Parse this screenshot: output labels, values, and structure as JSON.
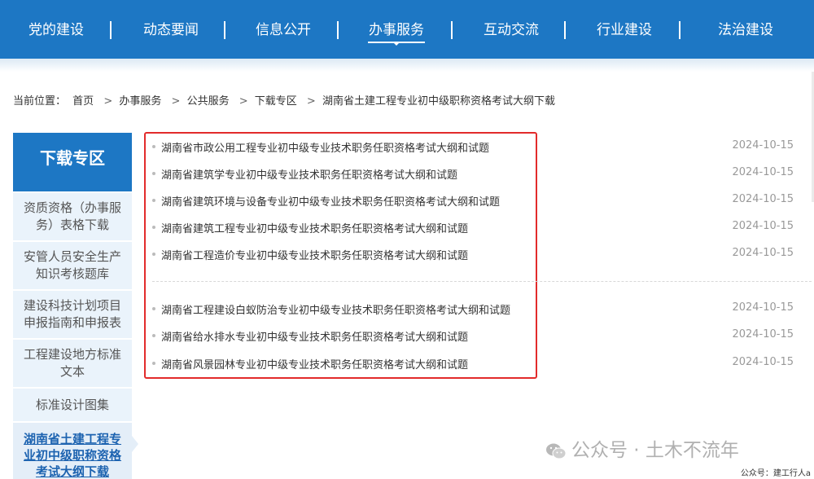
{
  "nav": {
    "items": [
      {
        "label": "党的建设"
      },
      {
        "label": "动态要闻"
      },
      {
        "label": "信息公开"
      },
      {
        "label": "办事服务"
      },
      {
        "label": "互动交流"
      },
      {
        "label": "行业建设"
      },
      {
        "label": "法治建设"
      }
    ],
    "active_index": 3
  },
  "breadcrumb": {
    "prefix": "当前位置：",
    "items": [
      "首页",
      "办事服务",
      "公共服务",
      "下载专区",
      "湖南省土建工程专业初中级职称资格考试大纲下载"
    ],
    "separator": ">"
  },
  "sidebar": {
    "title": "下载专区",
    "items": [
      {
        "label": "资质资格（办事服务）表格下载"
      },
      {
        "label": "安管人员安全生产知识考核题库"
      },
      {
        "label": "建设科技计划项目申报指南和申报表"
      },
      {
        "label": "工程建设地方标准文本"
      },
      {
        "label": "标准设计图集"
      },
      {
        "label": "湖南省土建工程专业初中级职称资格考试大纲下载"
      }
    ],
    "active_index": 5
  },
  "documents": [
    {
      "title": "湖南省市政公用工程专业初中级专业技术职务任职资格考试大纲和试题",
      "date": "2024-10-15"
    },
    {
      "title": "湖南省建筑学专业初中级专业技术职务任职资格考试大纲和试题",
      "date": "2024-10-15"
    },
    {
      "title": "湖南省建筑环境与设备专业初中级专业技术职务任职资格考试大纲和试题",
      "date": "2024-10-15"
    },
    {
      "title": "湖南省建筑工程专业初中级专业技术职务任职资格考试大纲和试题",
      "date": "2024-10-15"
    },
    {
      "title": "湖南省工程造价专业初中级专业技术职务任职资格考试大纲和试题",
      "date": "2024-10-15"
    },
    {
      "title": "湖南省工程建设白蚁防治专业初中级专业技术职务任职资格考试大纲和试题",
      "date": "2024-10-15"
    },
    {
      "title": "湖南省给水排水专业初中级专业技术职务任职资格考试大纲和试题",
      "date": "2024-10-15"
    },
    {
      "title": "湖南省风景园林专业初中级专业技术职务任职资格考试大纲和试题",
      "date": "2024-10-15"
    }
  ],
  "watermark": {
    "text": "公众号 · 土木不流年",
    "icon": "wechat-icon"
  },
  "footnote": "公众号：建工行人a",
  "colors": {
    "nav_bg": "#1d77c4",
    "sidebar_bg": "#eaf3fb",
    "active_text": "#1d63b0",
    "highlight_border": "#e22b2b"
  }
}
